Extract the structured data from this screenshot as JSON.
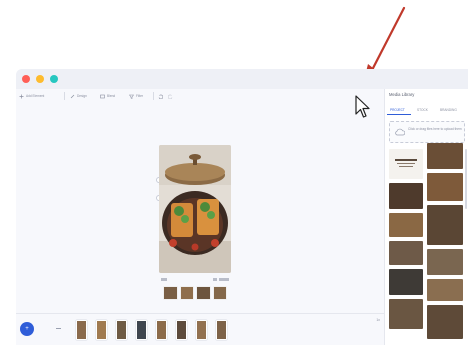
{
  "toolbar": {
    "items": [
      {
        "label": "Add Element",
        "icon": "add-element-icon"
      },
      {
        "label": "Design",
        "icon": "pen-icon"
      },
      {
        "label": "Blend",
        "icon": "blend-icon"
      },
      {
        "label": "Filter",
        "icon": "filter-icon"
      }
    ],
    "undo_icon": "undo-icon",
    "redo_icon": "redo-icon"
  },
  "media_library": {
    "title": "Media Library",
    "tabs": [
      "PROJECT",
      "STOCK",
      "BRANDING"
    ],
    "active_tab": "PROJECT",
    "upload_hint": "Click or drag files here to upload them"
  },
  "timeline": {
    "add_icon": "plus-icon",
    "zoom_label": "1x"
  },
  "colors": {
    "accent": "#2f5dd8",
    "annotation_arrow": "#c0392b",
    "traffic_red": "#ff5f57",
    "traffic_yellow": "#febc2e",
    "traffic_teal": "#27c7c0"
  }
}
